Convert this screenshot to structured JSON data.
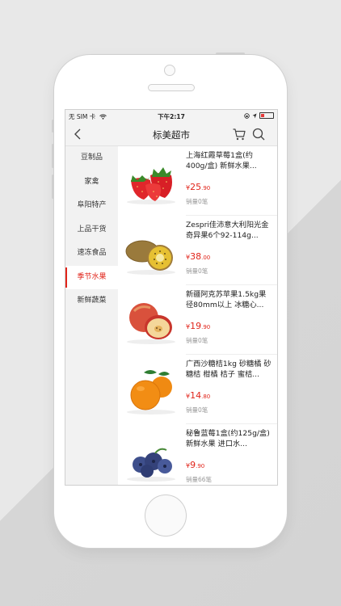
{
  "status_bar": {
    "carrier": "无 SIM 卡",
    "time": "下午2:17"
  },
  "nav": {
    "title": "标美超市",
    "icons": {
      "back": "chevron-left-icon",
      "cart": "cart-icon",
      "search": "search-icon"
    }
  },
  "categories": [
    "豆制品",
    "家禽",
    "阜阳特产",
    "上品干货",
    "速冻食品",
    "季节水果",
    "新鲜蔬菜"
  ],
  "active_category": "季节水果",
  "accent_color": "#e1251b",
  "products": [
    {
      "name": "上海红霞草莓1盒(约400g/盒) 新鲜水果...",
      "currency": "¥",
      "price_int": "25",
      "price_dec": ".90",
      "sales": "销量0笔",
      "image": "strawberry"
    },
    {
      "name": "Zespri佳沛意大利阳光金奇异果6个92-114g...",
      "currency": "¥",
      "price_int": "38",
      "price_dec": ".00",
      "sales": "销量0笔",
      "image": "kiwi"
    },
    {
      "name": "新疆阿克苏苹果1.5kg果径80mm以上 冰糖心...",
      "currency": "¥",
      "price_int": "19",
      "price_dec": ".90",
      "sales": "销量0笔",
      "image": "apple"
    },
    {
      "name": "广西沙糖桔1kg 砂糖橘 砂糖桔 柑橘 桔子 蜜桔...",
      "currency": "¥",
      "price_int": "14",
      "price_dec": ".80",
      "sales": "销量0笔",
      "image": "tangerine"
    },
    {
      "name": "秘鲁蓝莓1盒(约125g/盒) 新鲜水果 进口水...",
      "currency": "¥",
      "price_int": "9",
      "price_dec": ".90",
      "sales": "销量66笔",
      "image": "blueberry"
    }
  ]
}
